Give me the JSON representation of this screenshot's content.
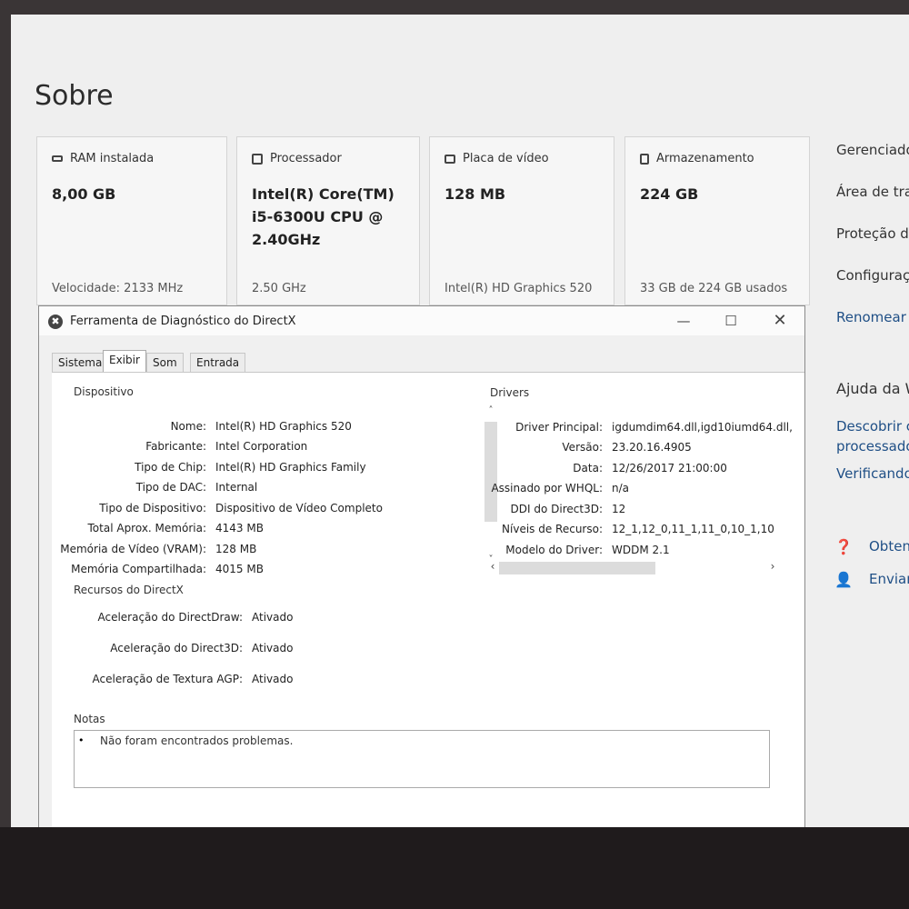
{
  "page": {
    "title": "Sobre"
  },
  "cards": [
    {
      "label": "RAM instalada",
      "icon": "ram-icon",
      "value": "8,00 GB",
      "sub": "Velocidade: 2133 MHz"
    },
    {
      "label": "Processador",
      "icon": "cpu-icon",
      "value": "Intel(R) Core(TM) i5-6300U CPU @ 2.40GHz",
      "sub": "2.50 GHz"
    },
    {
      "label": "Placa de vídeo",
      "icon": "gpu-icon",
      "value": "128 MB",
      "sub": "Intel(R) HD Graphics 520"
    },
    {
      "label": "Armazenamento",
      "icon": "storage-icon",
      "value": "224 GB",
      "sub": "33 GB de 224 GB usados"
    }
  ],
  "sidebar": {
    "links": [
      "Gerenciado",
      "Área de tra",
      "Proteção d",
      "Configuraç",
      "Renomear"
    ],
    "help_title": "Ajuda da W",
    "help_links": [
      "Descobrir c",
      "processado",
      "Verificando"
    ],
    "actions": [
      {
        "icon": "help-person-icon",
        "label": "Obten"
      },
      {
        "icon": "feedback-icon",
        "label": "Enviar"
      }
    ]
  },
  "dialog": {
    "title": "Ferramenta de Diagnóstico do DirectX",
    "tabs": [
      "Sistema",
      "Exibir",
      "Som",
      "Entrada"
    ],
    "active_tab": "Exibir",
    "device": {
      "heading": "Dispositivo",
      "fields": [
        {
          "label": "Nome:",
          "value": "Intel(R) HD Graphics 520"
        },
        {
          "label": "Fabricante:",
          "value": "Intel Corporation"
        },
        {
          "label": "Tipo de Chip:",
          "value": "Intel(R) HD Graphics Family"
        },
        {
          "label": "Tipo de DAC:",
          "value": "Internal"
        },
        {
          "label": "Tipo de Dispositivo:",
          "value": "Dispositivo de Vídeo Completo"
        },
        {
          "label": "Total Aprox. Memória:",
          "value": "4143 MB"
        },
        {
          "label": "Memória de Vídeo (VRAM):",
          "value": "128 MB"
        },
        {
          "label": "Memória Compartilhada:",
          "value": "4015 MB"
        }
      ]
    },
    "drivers": {
      "heading": "Drivers",
      "fields": [
        {
          "label": "Driver Principal:",
          "value": "igdumdim64.dll,igd10iumd64.dll,"
        },
        {
          "label": "Versão:",
          "value": "23.20.16.4905"
        },
        {
          "label": "Data:",
          "value": "12/26/2017 21:00:00"
        },
        {
          "label": "Assinado por WHQL:",
          "value": "n/a"
        },
        {
          "label": "DDI do Direct3D:",
          "value": "12"
        },
        {
          "label": "Níveis de Recurso:",
          "value": "12_1,12_0,11_1,11_0,10_1,10"
        },
        {
          "label": "Modelo do Driver:",
          "value": "WDDM 2.1"
        }
      ]
    },
    "directx": {
      "heading": "Recursos do DirectX",
      "fields": [
        {
          "label": "Aceleração do DirectDraw:",
          "value": "Ativado"
        },
        {
          "label": "Aceleração do Direct3D:",
          "value": "Ativado"
        },
        {
          "label": "Aceleração de Textura AGP:",
          "value": "Ativado"
        }
      ]
    },
    "notes": {
      "heading": "Notas",
      "bullet": "•",
      "text": "Não foram encontrados problemas."
    }
  }
}
